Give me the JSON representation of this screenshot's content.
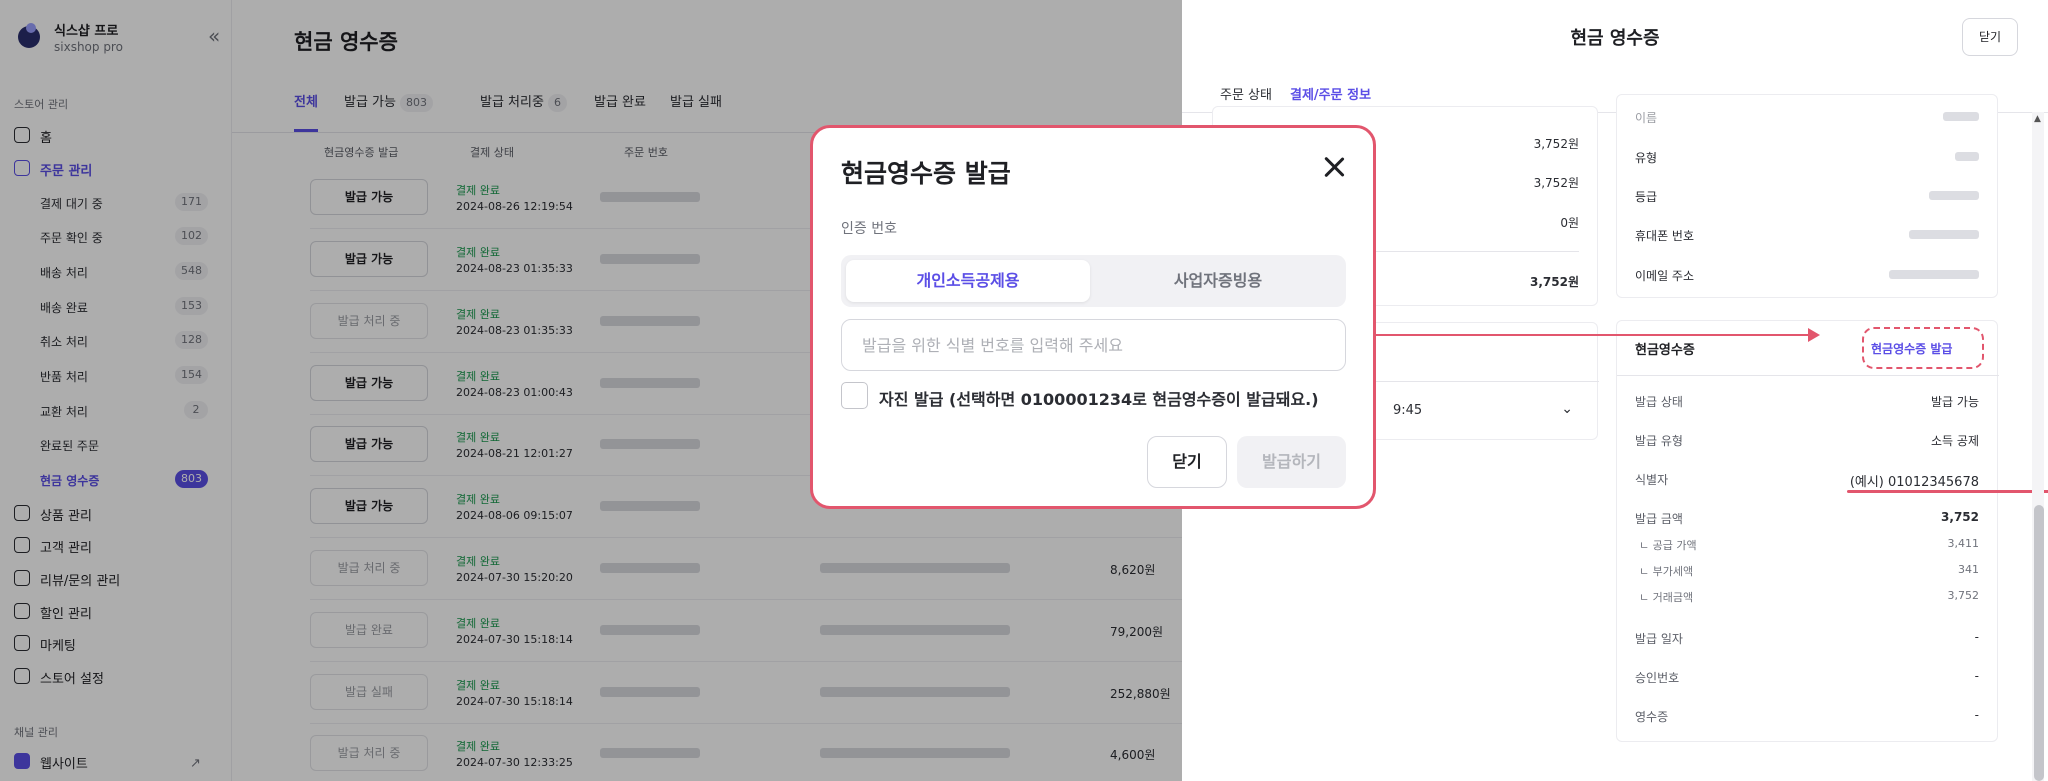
{
  "sidebar": {
    "store_name": "식스샵 프로",
    "plan": "sixshop pro",
    "section_store": "스토어 관리",
    "home": "홈",
    "orders": "주문 관리",
    "order_subs": [
      {
        "label": "결제 대기 중",
        "count": "171"
      },
      {
        "label": "주문 확인 중",
        "count": "102"
      },
      {
        "label": "배송 처리",
        "count": "548"
      },
      {
        "label": "배송 완료",
        "count": "153"
      },
      {
        "label": "취소 처리",
        "count": "128"
      },
      {
        "label": "반품 처리",
        "count": "154"
      },
      {
        "label": "교환 처리",
        "count": "2"
      },
      {
        "label": "완료된 주문",
        "count": ""
      },
      {
        "label": "현금 영수증",
        "count": "803"
      }
    ],
    "products": "상품 관리",
    "customers": "고객 관리",
    "reviews": "리뷰/문의 관리",
    "discounts": "할인 관리",
    "marketing": "마케팅",
    "settings": "스토어 설정",
    "section_channel": "채널 관리",
    "website": "웹사이트"
  },
  "main": {
    "title": "현금 영수증",
    "tabs": [
      {
        "label": "전체",
        "count": ""
      },
      {
        "label": "발급 가능",
        "count": "803"
      },
      {
        "label": "발급 처리중",
        "count": "6"
      },
      {
        "label": "발급 완료",
        "count": ""
      },
      {
        "label": "발급 실패",
        "count": ""
      }
    ],
    "columns": [
      "현금영수증 발급",
      "결제 상태",
      "주문 번호"
    ],
    "rows": [
      {
        "btn": "발급 가능",
        "status": "결제 완료",
        "date": "2024-08-26 12:19:54",
        "amount": ""
      },
      {
        "btn": "발급 가능",
        "status": "결제 완료",
        "date": "2024-08-23 01:35:33",
        "amount": ""
      },
      {
        "btn": "발급 처리 중",
        "status": "결제 완료",
        "date": "2024-08-23 01:35:33",
        "amount": ""
      },
      {
        "btn": "발급 가능",
        "status": "결제 완료",
        "date": "2024-08-23 01:00:43",
        "amount": ""
      },
      {
        "btn": "발급 가능",
        "status": "결제 완료",
        "date": "2024-08-21 12:01:27",
        "amount": ""
      },
      {
        "btn": "발급 가능",
        "status": "결제 완료",
        "date": "2024-08-06 09:15:07",
        "amount": ""
      },
      {
        "btn": "발급 처리 중",
        "status": "결제 완료",
        "date": "2024-07-30 15:20:20",
        "amount": "8,620원"
      },
      {
        "btn": "발급 완료",
        "status": "결제 완료",
        "date": "2024-07-30 15:18:14",
        "amount": "79,200원"
      },
      {
        "btn": "발급 실패",
        "status": "결제 완료",
        "date": "2024-07-30 15:18:14",
        "amount": "252,880원"
      },
      {
        "btn": "발급 처리 중",
        "status": "결제 완료",
        "date": "2024-07-30 12:33:25",
        "amount": "4,600원"
      }
    ]
  },
  "panel": {
    "title": "현금 영수증",
    "close": "닫기",
    "tabs": [
      "주문 상태",
      "결제/주문 정보"
    ],
    "payment_values": [
      "3,752원",
      "3,752원",
      "0원",
      "3,752원"
    ],
    "time_partial": "9:45",
    "customer_labels": [
      "이름",
      "유형",
      "등급",
      "휴대폰 번호",
      "이메일 주소"
    ],
    "receipt": {
      "title": "현금영수증",
      "issue_link": "현금영수증 발급",
      "rows": [
        {
          "label": "발급 상태",
          "value": "발급 가능"
        },
        {
          "label": "발급 유형",
          "value": "소득 공제"
        },
        {
          "label": "식별자",
          "value": "(예시) 01012345678"
        },
        {
          "label": "발급 금액",
          "value": "3,752"
        },
        {
          "label": "ㄴ 공급 가액",
          "value": "3,411"
        },
        {
          "label": "ㄴ 부가세액",
          "value": "341"
        },
        {
          "label": "ㄴ 거래금액",
          "value": "3,752"
        },
        {
          "label": "발급 일자",
          "value": "-"
        },
        {
          "label": "승인번호",
          "value": "-"
        },
        {
          "label": "영수증",
          "value": "-"
        }
      ]
    }
  },
  "modal": {
    "title": "현금영수증 발급",
    "auth_label": "인증 번호",
    "seg_personal": "개인소득공제용",
    "seg_business": "사업자증빙용",
    "input_placeholder": "발급을 위한 식별 번호를 입력해 주세요",
    "input_value": "",
    "self_issue": "자진 발급 (선택하면 0100001234로 현금영수증이 발급돼요.)",
    "close": "닫기",
    "issue": "발급하기"
  },
  "colors": {
    "accent": "#5b4ee6",
    "highlight": "#e2566d",
    "paid": "#1a9a4f"
  },
  "icons": [
    "logo-icon",
    "collapse-icon",
    "home-icon",
    "clipboard-icon",
    "box-icon",
    "users-icon",
    "chat-icon",
    "discount-icon",
    "marketing-icon",
    "gear-icon",
    "website-icon",
    "external-link-icon",
    "close-icon",
    "chevron-down-icon",
    "checkbox-icon"
  ]
}
